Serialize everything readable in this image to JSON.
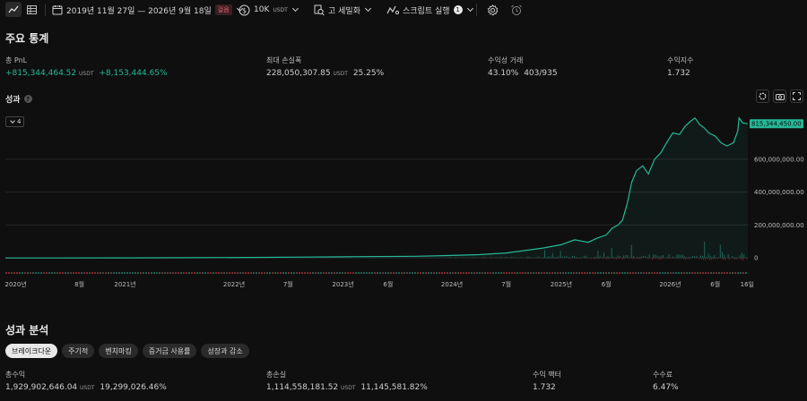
{
  "toolbar": {
    "date_range": "2019년 11월 27일 — 2026년 9월 18일",
    "date_badge": "걸음",
    "capital": "10K",
    "capital_unit": "USDT",
    "detail": "고 세밀화",
    "script_run": "스크립트 실행",
    "script_count": "1"
  },
  "key_stats": {
    "title": "주요 통계",
    "items": [
      {
        "label": "총 PnL",
        "value": "+815,344,464.52",
        "unit": "USDT",
        "extra": "+8,153,444.65%",
        "green": true
      },
      {
        "label": "최대 손실폭",
        "value": "228,050,307.85",
        "unit": "USDT",
        "extra": "25.25%",
        "green": false
      },
      {
        "label": "수익성 거래",
        "value": "43.10%",
        "unit": "",
        "extra": "403/935",
        "green": false
      },
      {
        "label": "수익지수",
        "value": "1.732",
        "unit": "",
        "extra": "",
        "green": false
      }
    ]
  },
  "performance": {
    "title": "성과",
    "help": "?",
    "dropdown": "4",
    "last_value_label": "815,344,450.00"
  },
  "chart_data": {
    "type": "area",
    "y_ticks": [
      "600,000,000.00",
      "400,000,000.00",
      "200,000,000.00",
      "0"
    ],
    "y_tick_values": [
      600000000,
      400000000,
      200000000,
      0
    ],
    "ylim": [
      -10000000,
      860000000
    ],
    "x_ticks": [
      "2020년",
      "8월",
      "2021년",
      "2022년",
      "7월",
      "2023년",
      "6월",
      "2024년",
      "7월",
      "2025년",
      "6월",
      "2026년",
      "6월",
      "16일"
    ],
    "x_tick_dates": [
      "2020-01-01",
      "2020-08-01",
      "2021-01-01",
      "2022-01-01",
      "2022-07-01",
      "2023-01-01",
      "2023-06-01",
      "2024-01-01",
      "2024-07-01",
      "2025-01-01",
      "2025-06-01",
      "2026-01-01",
      "2026-06-01",
      "2026-09-16"
    ],
    "xlim": [
      "2019-11-27",
      "2026-09-18"
    ],
    "series": [
      {
        "name": "",
        "color": "#26b896",
        "points": [
          [
            "2019-11-27",
            0
          ],
          [
            "2020-06-01",
            0
          ],
          [
            "2021-01-01",
            500000
          ],
          [
            "2021-08-01",
            1500000
          ],
          [
            "2022-03-01",
            3000000
          ],
          [
            "2022-09-01",
            5000000
          ],
          [
            "2023-03-01",
            8000000
          ],
          [
            "2023-09-01",
            10000000
          ],
          [
            "2024-01-01",
            15000000
          ],
          [
            "2024-04-01",
            20000000
          ],
          [
            "2024-07-01",
            30000000
          ],
          [
            "2024-09-01",
            45000000
          ],
          [
            "2024-11-01",
            60000000
          ],
          [
            "2025-01-01",
            80000000
          ],
          [
            "2025-02-15",
            110000000
          ],
          [
            "2025-04-01",
            95000000
          ],
          [
            "2025-05-01",
            120000000
          ],
          [
            "2025-06-01",
            140000000
          ],
          [
            "2025-06-20",
            180000000
          ],
          [
            "2025-07-10",
            200000000
          ],
          [
            "2025-07-25",
            230000000
          ],
          [
            "2025-08-10",
            330000000
          ],
          [
            "2025-08-25",
            460000000
          ],
          [
            "2025-09-10",
            530000000
          ],
          [
            "2025-10-01",
            560000000
          ],
          [
            "2025-10-20",
            510000000
          ],
          [
            "2025-11-10",
            600000000
          ],
          [
            "2025-12-01",
            640000000
          ],
          [
            "2025-12-20",
            700000000
          ],
          [
            "2026-01-10",
            760000000
          ],
          [
            "2026-02-01",
            750000000
          ],
          [
            "2026-02-20",
            800000000
          ],
          [
            "2026-03-10",
            830000000
          ],
          [
            "2026-03-25",
            850000000
          ],
          [
            "2026-04-10",
            810000000
          ],
          [
            "2026-04-25",
            790000000
          ],
          [
            "2026-05-10",
            760000000
          ],
          [
            "2026-06-01",
            740000000
          ],
          [
            "2026-06-20",
            700000000
          ],
          [
            "2026-07-10",
            680000000
          ],
          [
            "2026-08-01",
            700000000
          ],
          [
            "2026-08-15",
            770000000
          ],
          [
            "2026-08-20",
            850000000
          ],
          [
            "2026-09-01",
            820000000
          ],
          [
            "2026-09-18",
            815344450
          ]
        ]
      }
    ],
    "grid": true
  },
  "analysis": {
    "title": "성과 분석",
    "tabs": [
      "브레이크다운",
      "주기적",
      "벤치마킹",
      "증거금 사용률",
      "성장과 감소"
    ],
    "active_tab": 0,
    "items": [
      {
        "label": "총수익",
        "value": "1,929,902,646.04",
        "unit": "USDT",
        "extra": "19,299,026.46%"
      },
      {
        "label": "총손실",
        "value": "1,114,558,181.52",
        "unit": "USDT",
        "extra": "11,145,581.82%"
      },
      {
        "label": "수익 팩터",
        "value": "1.732",
        "unit": "",
        "extra": ""
      },
      {
        "label": "수수료",
        "value": "6.47%",
        "unit": "",
        "extra": ""
      }
    ]
  },
  "colors": {
    "accent": "#26b896",
    "loss": "#e2636f",
    "background": "#0f0f0f"
  }
}
